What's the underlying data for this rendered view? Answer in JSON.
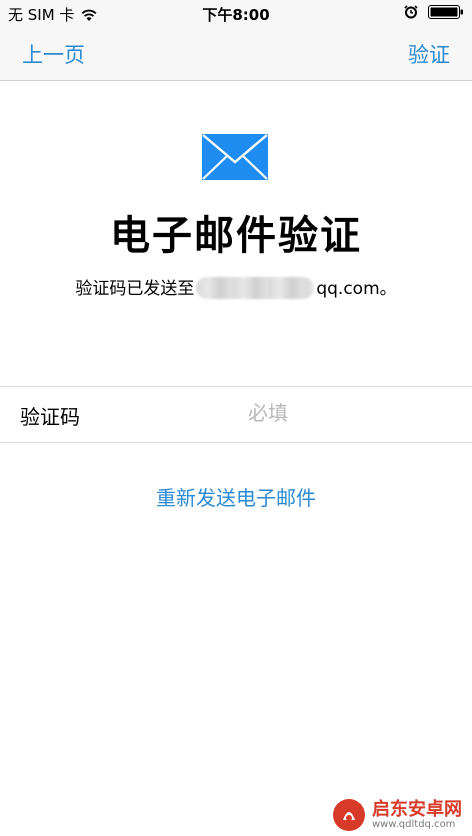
{
  "status_bar": {
    "carrier": "无 SIM 卡",
    "time": "下午8:00",
    "icons": [
      "wifi-icon",
      "alarm-icon",
      "battery-icon"
    ]
  },
  "nav": {
    "back_label": "上一页",
    "verify_label": "验证"
  },
  "header": {
    "icon": "mail-icon",
    "title": "电子邮件验证",
    "sent_prefix": "验证码已发送至",
    "sent_email_suffix": "qq.com。"
  },
  "form": {
    "code_label": "验证码",
    "code_placeholder": "必填",
    "code_value": ""
  },
  "resend_label": "重新发送电子邮件",
  "watermark": {
    "name": "启东安卓网",
    "url": "www.qdltdq.com"
  },
  "colors": {
    "accent": "#2a8ad4",
    "mail_icon": "#1e8cf0",
    "watermark": "#d83a2a"
  }
}
